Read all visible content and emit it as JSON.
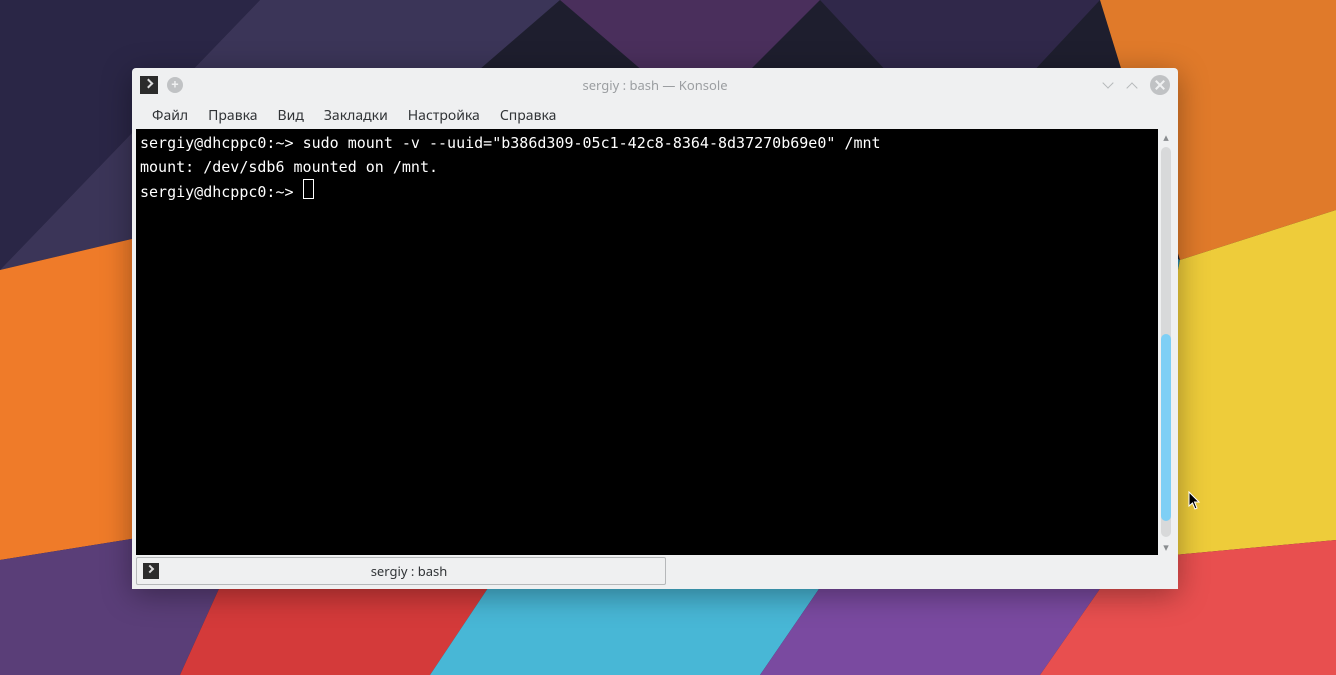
{
  "window": {
    "title": "sergiy : bash — Konsole"
  },
  "menu": {
    "items": [
      "Файл",
      "Правка",
      "Вид",
      "Закладки",
      "Настройка",
      "Справка"
    ]
  },
  "terminal": {
    "lines": [
      {
        "prompt": "sergiy@dhcppc0:~> ",
        "cmd": "sudo mount -v --uuid=\"b386d309-05c1-42c8-8364-8d37270b69e0\" /mnt"
      },
      {
        "text": "mount: /dev/sdb6 mounted on /mnt."
      },
      {
        "prompt": "sergiy@dhcppc0:~> ",
        "cursor": true
      }
    ]
  },
  "tab": {
    "label": "sergiy : bash"
  }
}
